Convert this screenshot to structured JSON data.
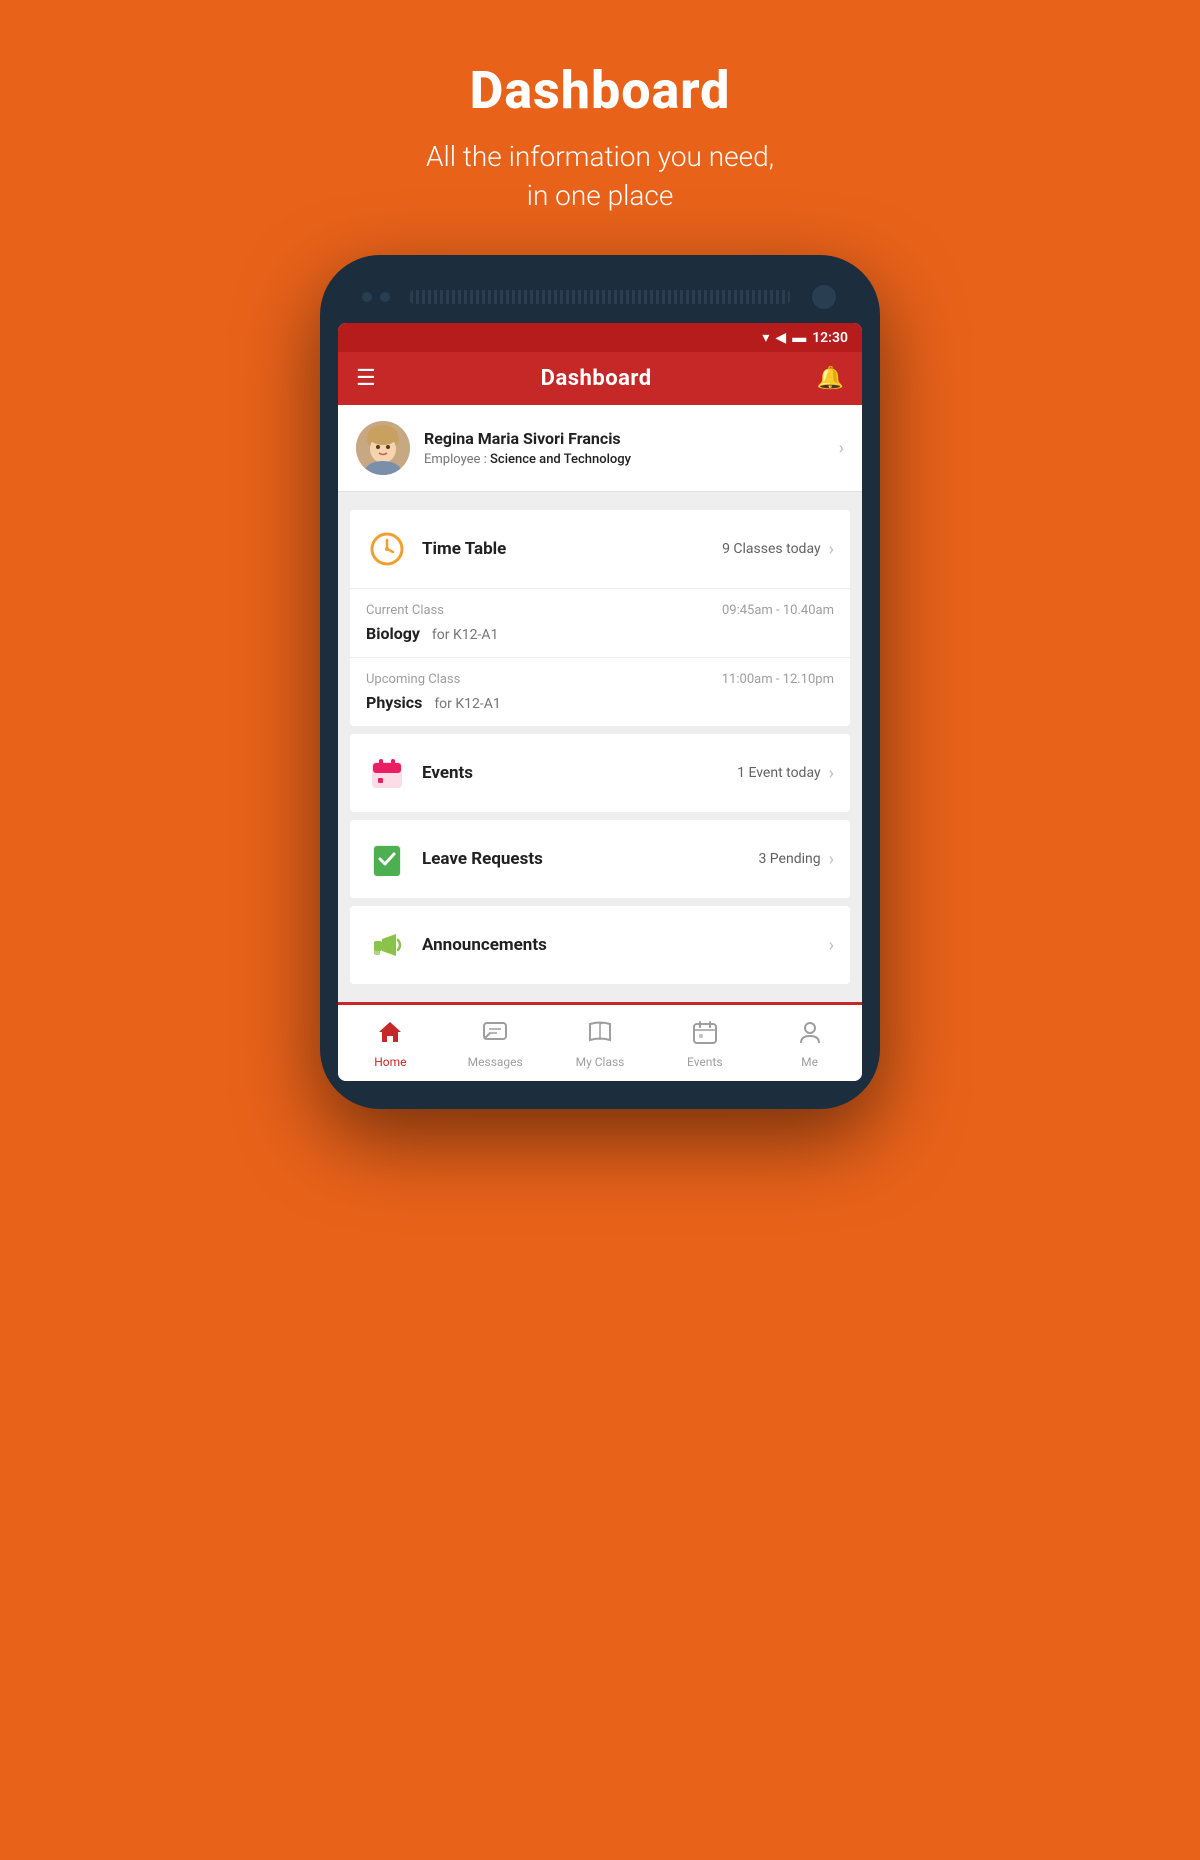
{
  "page": {
    "title": "Dashboard",
    "subtitle_line1": "All the information you need,",
    "subtitle_line2": "in one place"
  },
  "status_bar": {
    "time": "12:30"
  },
  "app_bar": {
    "title": "Dashboard",
    "menu_icon": "☰",
    "bell_icon": "🔔"
  },
  "user": {
    "name": "Regina Maria Sivori Francis",
    "role_label": "Employee : ",
    "role_value": "Science and Technology"
  },
  "timetable": {
    "label": "Time Table",
    "count_text": "9 Classes today",
    "current_class": {
      "type": "Current Class",
      "time": "09:45am - 10.40am",
      "subject": "Biology",
      "group": "for K12-A1"
    },
    "upcoming_class": {
      "type": "Upcoming Class",
      "time": "11:00am - 12.10pm",
      "subject": "Physics",
      "group": "for K12-A1"
    }
  },
  "events": {
    "label": "Events",
    "count_text": "1 Event today"
  },
  "leave_requests": {
    "label": "Leave Requests",
    "count_text": "3 Pending"
  },
  "announcements": {
    "label": "Announcements",
    "count_text": ""
  },
  "bottom_nav": {
    "items": [
      {
        "label": "Home",
        "icon": "🏠",
        "active": true
      },
      {
        "label": "Messages",
        "icon": "💬",
        "active": false
      },
      {
        "label": "My Class",
        "icon": "📖",
        "active": false
      },
      {
        "label": "Events",
        "icon": "📅",
        "active": false
      },
      {
        "label": "Me",
        "icon": "👤",
        "active": false
      }
    ]
  }
}
